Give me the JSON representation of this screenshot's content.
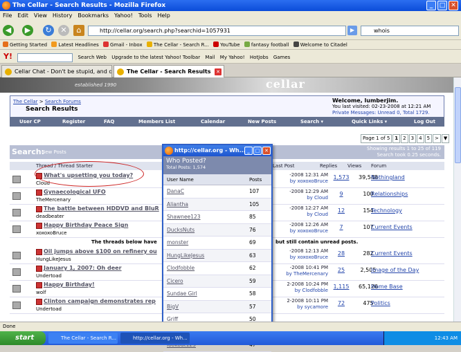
{
  "window": {
    "title": "The Cellar - Search Results - Mozilla Firefox"
  },
  "menu": [
    "File",
    "Edit",
    "View",
    "History",
    "Bookmarks",
    "Yahoo!",
    "Tools",
    "Help"
  ],
  "nav": {
    "url": "http://cellar.org/search.php?searchid=1057931",
    "search_value": "whois"
  },
  "bookmarks": [
    "Getting Started",
    "Latest Headlines",
    "Gmail - Inbox",
    "The Cellar - Search R...",
    "YouTube",
    "fantasy football",
    "Welcome to Citadel"
  ],
  "yahoo": {
    "search_label": "Search Web",
    "items": [
      "Upgrade to the latest Yahoo! Toolbar",
      "Mail",
      "My Yahoo!",
      "HotJobs",
      "Games"
    ]
  },
  "tabs": [
    {
      "label": "Cellar Chat - Don't be stupid, and don'..."
    },
    {
      "label": "The Cellar - Search Results"
    }
  ],
  "page": {
    "tagline": "established 1990",
    "logo": "cellar",
    "breadcrumb_link1": "The Cellar",
    "breadcrumb_link2": "Search Forums",
    "breadcrumb_title": "Search Results",
    "welcome_title": "Welcome, lumberjim.",
    "welcome_line1": "You last visited: 02-23-2008 at 12:21 AM",
    "welcome_line2": "Private Messages: Unread 0, Total 1729.",
    "nav": [
      "User CP",
      "Register",
      "FAQ",
      "Members List",
      "Calendar",
      "New Posts",
      "Search ▾",
      "Quick Links ▾",
      "Log Out"
    ],
    "pager": [
      "Page 1 of 5",
      "1",
      "2",
      "3",
      "4",
      "5",
      ">",
      "▼"
    ],
    "search_title": "Search:",
    "search_sub": "New Posts",
    "search_info1": "Showing results 1 to 25 of 119",
    "search_info2": "Search took 0.25 seconds.",
    "col_thread": "Thread / Thread Starter",
    "col_last": "Last Post",
    "col_replies": "Replies",
    "col_views": "Views",
    "col_forum": "Forum",
    "notice": "The threads below have",
    "notice2": "but still contain unread posts.",
    "rows": [
      {
        "title": "What's upsetting you today?",
        "pages": "1 2 3 4 5",
        "starter": "Cloud",
        "lp1": "-2008 12:31 AM",
        "lp2": "by xoxoxoBruce",
        "replies": "1,573",
        "views": "39,548",
        "forum": "Nothingland"
      },
      {
        "title": "Gynaecological UFO",
        "pages": "",
        "starter": "TheMercenary",
        "lp1": "-2008 12:29 AM",
        "lp2": "by Cloud",
        "replies": "9",
        "views": "100",
        "forum": "Relationships"
      },
      {
        "title": "The battle between HDDVD and BluR",
        "pages": "",
        "starter": "deadbeater",
        "lp1": "-2008 12:27 AM",
        "lp2": "by Cloud",
        "replies": "12",
        "views": "154",
        "forum": "Technology"
      },
      {
        "title": "Happy Birthday Peace Sign",
        "pages": "",
        "starter": "xoxoxoBruce",
        "lp1": "-2008 12:26 AM",
        "lp2": "by xoxoxoBruce",
        "replies": "7",
        "views": "107",
        "forum": "Current Events"
      },
      {
        "title": "Oil jumps above $100 on refinery ou",
        "pages": "",
        "starter": "HungLikeJesus",
        "lp1": "-2008 12:13 AM",
        "lp2": "by xoxoxoBruce",
        "replies": "28",
        "views": "282",
        "forum": "Current Events"
      },
      {
        "title": "January 1, 2007: Oh deer",
        "pages": "",
        "starter": "Undertoad",
        "lp1": "-2008 10:41 PM",
        "lp2": "by TheMercenary",
        "replies": "25",
        "views": "2,505",
        "forum": "Image of the Day"
      },
      {
        "title": "Happy Birthday!",
        "pages": "1 2 3 4 5",
        "starter": "wolf",
        "lp1": "2-2008 10:24 PM",
        "lp2": "by Clodfobble",
        "replies": "1,115",
        "views": "65,126",
        "forum": "Home Base"
      },
      {
        "title": "Clinton campaign demonstrates rep",
        "pages": "",
        "starter": "Undertoad",
        "lp1": "2-2008 10:11 PM",
        "lp2": "by sycamore",
        "replies": "72",
        "views": "475",
        "forum": "Politics"
      }
    ]
  },
  "popup": {
    "title": "http://cellar.org - Wh...",
    "heading": "Who Posted?",
    "total": "Total Posts: 1,574",
    "col_user": "User Name",
    "col_posts": "Posts",
    "users": [
      {
        "u": "DanaC",
        "p": "107"
      },
      {
        "u": "Aliantha",
        "p": "105"
      },
      {
        "u": "Shawnee123",
        "p": "85"
      },
      {
        "u": "DucksNuts",
        "p": "76"
      },
      {
        "u": "monster",
        "p": "69"
      },
      {
        "u": "HungLikeJesus",
        "p": "63"
      },
      {
        "u": "Clodfobble",
        "p": "62"
      },
      {
        "u": "Cicero",
        "p": "59"
      },
      {
        "u": "Sundae Girl",
        "p": "58"
      },
      {
        "u": "BigV",
        "p": "57"
      },
      {
        "u": "Griff",
        "p": "50"
      },
      {
        "u": "ZenGum",
        "p": "48"
      },
      {
        "u": "lookout123",
        "p": "47"
      }
    ]
  },
  "status": "Done",
  "taskbar": {
    "start": "start",
    "items": [
      "The Cellar - Search R...",
      "http://cellar.org - Wh..."
    ],
    "clock": "12:43 AM"
  }
}
